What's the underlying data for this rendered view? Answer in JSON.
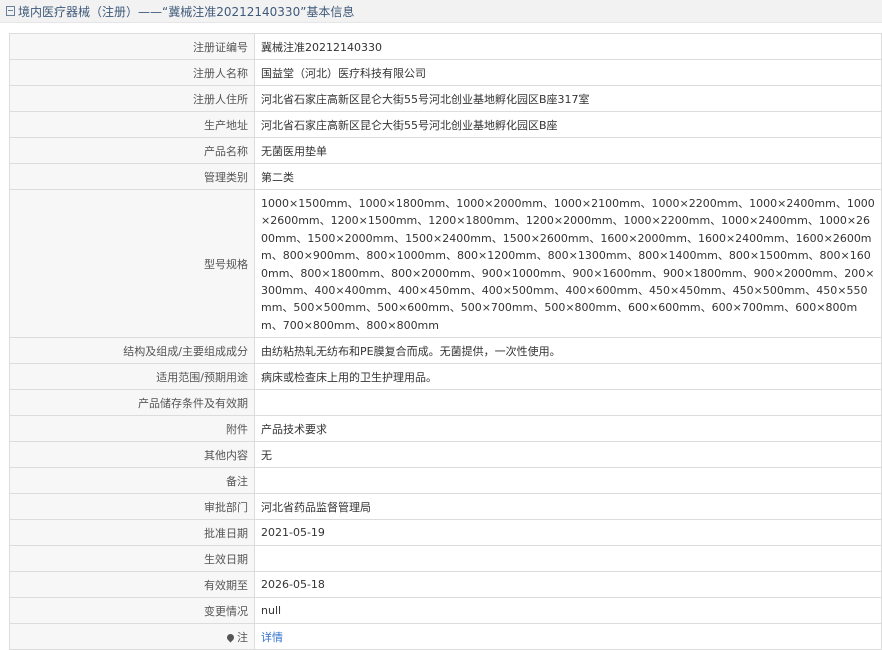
{
  "header": {
    "title": "境内医疗器械（注册）——“冀械注准20212140330”基本信息"
  },
  "rows": [
    {
      "label": "注册证编号",
      "value": "冀械注准20212140330"
    },
    {
      "label": "注册人名称",
      "value": "国益堂（河北）医疗科技有限公司"
    },
    {
      "label": "注册人住所",
      "value": "河北省石家庄高新区昆仑大街55号河北创业基地孵化园区B座317室"
    },
    {
      "label": "生产地址",
      "value": "河北省石家庄高新区昆仑大街55号河北创业基地孵化园区B座"
    },
    {
      "label": "产品名称",
      "value": "无菌医用垫单"
    },
    {
      "label": "管理类别",
      "value": "第二类"
    },
    {
      "label": "型号规格",
      "value": "1000×1500mm、1000×1800mm、1000×2000mm、1000×2100mm、1000×2200mm、1000×2400mm、1000×2600mm、1200×1500mm、1200×1800mm、1200×2000mm、1000×2200mm、1000×2400mm、1000×2600mm、1500×2000mm、1500×2400mm、1500×2600mm、1600×2000mm、1600×2400mm、1600×2600mm、800×900mm、800×1000mm、800×1200mm、800×1300mm、800×1400mm、800×1500mm、800×1600mm、800×1800mm、800×2000mm、900×1000mm、900×1600mm、900×1800mm、900×2000mm、200×300mm、400×400mm、400×450mm、400×500mm、400×600mm、450×450mm、450×500mm、450×550mm、500×500mm、500×600mm、500×700mm、500×800mm、600×600mm、600×700mm、600×800mm、700×800mm、800×800mm"
    },
    {
      "label": "结构及组成/主要组成成分",
      "value": "由纺粘热轧无纺布和PE膜复合而成。无菌提供，一次性使用。"
    },
    {
      "label": "适用范围/预期用途",
      "value": "病床或检查床上用的卫生护理用品。"
    },
    {
      "label": "产品储存条件及有效期",
      "value": ""
    },
    {
      "label": "附件",
      "value": "产品技术要求"
    },
    {
      "label": "其他内容",
      "value": "无"
    },
    {
      "label": "备注",
      "value": ""
    },
    {
      "label": "审批部门",
      "value": "河北省药品监督管理局"
    },
    {
      "label": "批准日期",
      "value": "2021-05-19"
    },
    {
      "label": "生效日期",
      "value": ""
    },
    {
      "label": "有效期至",
      "value": "2026-05-18"
    },
    {
      "label": "变更情况",
      "value": "null"
    }
  ],
  "note": {
    "label": "注",
    "icon": "pin-icon",
    "link_text": "详情"
  }
}
